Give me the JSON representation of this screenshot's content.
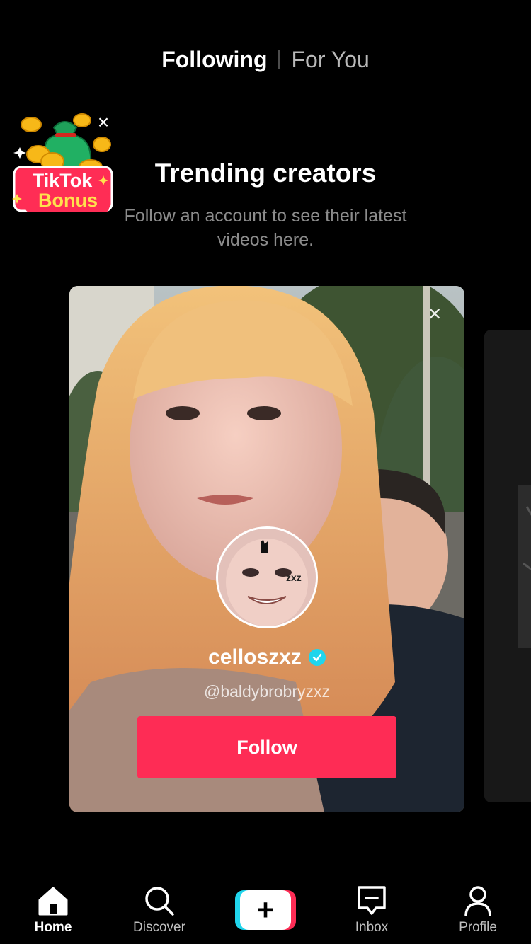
{
  "top_tabs": {
    "following": "Following",
    "for_you": "For You"
  },
  "bonus": {
    "line1": "TikTok",
    "line2": "Bonus",
    "close": "×"
  },
  "heading": {
    "title": "Trending creators",
    "subtitle": "Follow an account to see their latest videos here."
  },
  "creator_card": {
    "name": "celloszxz",
    "handle": "@baldybrobryzxz",
    "follow_label": "Follow",
    "close": "×",
    "avatar_text": "zxz"
  },
  "bottom_nav": {
    "home": "Home",
    "discover": "Discover",
    "create": "+",
    "inbox": "Inbox",
    "profile": "Profile"
  },
  "colors": {
    "accent": "#fe2c55",
    "cyan": "#20d5ec",
    "background": "#000000"
  }
}
